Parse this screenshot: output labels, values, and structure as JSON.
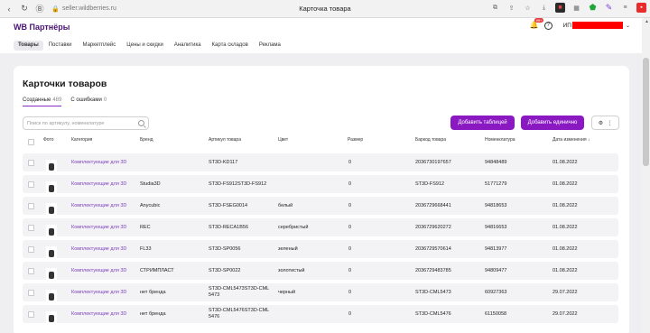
{
  "browser": {
    "url": "seller.wildberries.ru",
    "tab_title": "Карточка товара",
    "badge_count": "99+"
  },
  "header": {
    "logo": "WB Партнёры",
    "nav": [
      "Товары",
      "Поставки",
      "Маркетплейс",
      "Цены и скидки",
      "Аналитика",
      "Карта складов",
      "Реклама"
    ],
    "user_label": "ИП"
  },
  "page": {
    "title": "Карточки товаров",
    "tabs": [
      {
        "label": "Созданные",
        "count": "489"
      },
      {
        "label": "С ошибками",
        "count": "0"
      }
    ],
    "search_placeholder": "Поиск по артикулу, номенклатуре",
    "btn_add_table": "Добавить таблицей",
    "btn_add_single": "Добавить единично",
    "more_icon": "settings-more-icon"
  },
  "table": {
    "headers": [
      "Фото",
      "Категория",
      "Бренд",
      "Артикул товара",
      "Цвет",
      "Размер",
      "Баркод товара",
      "Номенклатура",
      "Дата изменения"
    ],
    "sort_indicator": "↓",
    "rows": [
      {
        "category": "Комплектующие для 3D",
        "brand": "",
        "article": "ST3D-KD117",
        "color": "",
        "size": "0",
        "barcode": "2036730197657",
        "nm": "94848489",
        "date": "01.08.2022"
      },
      {
        "category": "Комплектующие для 3D",
        "brand": "Studia3D",
        "article": "ST3D-FS912ST3D-FS912",
        "color": "",
        "size": "0",
        "barcode": "ST3D-FS912",
        "nm": "51771279",
        "date": "01.08.2022"
      },
      {
        "category": "Комплектующие для 3D",
        "brand": "Anycubic",
        "article": "ST3D-FSEG0014",
        "color": "белый",
        "size": "0",
        "barcode": "2036729668441",
        "nm": "94818653",
        "date": "01.08.2022"
      },
      {
        "category": "Комплектующие для 3D",
        "brand": "REC",
        "article": "ST3D-RECA1B56",
        "color": "серебристый",
        "size": "0",
        "barcode": "2036729620272",
        "nm": "94816653",
        "date": "01.08.2022"
      },
      {
        "category": "Комплектующие для 3D",
        "brand": "FL33",
        "article": "ST3D-SP0056",
        "color": "зеленый",
        "size": "0",
        "barcode": "2036729570614",
        "nm": "94813977",
        "date": "01.08.2022"
      },
      {
        "category": "Комплектующие для 3D",
        "brand": "СТРИМПЛАСТ",
        "article": "ST3D-SP0022",
        "color": "золотистый",
        "size": "0",
        "barcode": "2036729483785",
        "nm": "94809477",
        "date": "01.08.2022"
      },
      {
        "category": "Комплектующие для 3D",
        "brand": "нет бренда",
        "article": "ST3D-CML5473ST3D-CML",
        "article2": "5473",
        "color": "черный",
        "size": "0",
        "barcode": "ST3D-CML5473",
        "nm": "60927363",
        "date": "29.07.2022"
      },
      {
        "category": "Комплектующие для 3D",
        "brand": "нет бренда",
        "article": "ST3D-CML5476ST3D-CML",
        "article2": "5476",
        "color": "",
        "size": "0",
        "barcode": "ST3D-CML5476",
        "nm": "61150058",
        "date": "29.07.2022"
      }
    ]
  }
}
